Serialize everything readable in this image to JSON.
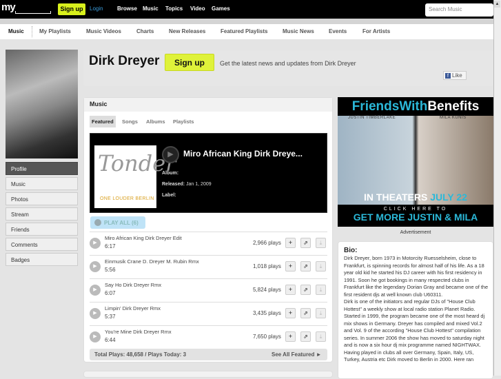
{
  "topbar": {
    "logo": "my",
    "signup": "Sign up",
    "login": "Login",
    "nav": [
      "Browse",
      "Music",
      "Topics",
      "Video",
      "Games"
    ],
    "search_placeholder": "Search Music"
  },
  "subnav": [
    "Music",
    "My Playlists",
    "Music Videos",
    "Charts",
    "New Releases",
    "Featured Playlists",
    "Music News",
    "Events",
    "For Artists"
  ],
  "sidebar": [
    "Profile",
    "Music",
    "Photos",
    "Stream",
    "Friends",
    "Comments",
    "Badges"
  ],
  "header": {
    "artist": "Dirk Dreyer",
    "signup": "Sign up",
    "tagline": "Get the latest news and updates from Dirk Dreyer",
    "like": "Like"
  },
  "music": {
    "title": "Music",
    "tabs": [
      "Featured",
      "Songs",
      "Albums",
      "Playlists"
    ],
    "featured": {
      "label": "",
      "title": "Miro African King Dirk Dreye...",
      "album_label": "Album:",
      "album": "",
      "released_label": "Released:",
      "released": "Jan 1, 2009",
      "label_label": "Label:",
      "cover_text": "Tonder",
      "cover_sub": "ONE LOUDER BERLIN"
    },
    "play_all": "PLAY ALL (6)",
    "tracks": [
      {
        "name": "Miro African King Dirk Dreyer Edit",
        "duration": "6:17",
        "plays": "2,966 plays"
      },
      {
        "name": "Einmusik Crane D. Dreyer M. Rubin Rmx",
        "duration": "5:56",
        "plays": "1,018 plays"
      },
      {
        "name": "Say Ho Dirk Dreyer Rmx",
        "duration": "6:07",
        "plays": "5,824 plays"
      },
      {
        "name": "Limpin' Dirk Dreyer Rmx",
        "duration": "5:37",
        "plays": "3,435 plays"
      },
      {
        "name": "You're Mine Dirk Dreyer Rmx",
        "duration": "6:44",
        "plays": "7,650 plays"
      }
    ],
    "totals": "Total Plays: 48,658 / Plays Today: 3",
    "see_all": "See All Featured ►"
  },
  "ad": {
    "title_a": "Friends",
    "title_b": "With",
    "title_c": "Benefits",
    "name1": "JUSTIN TIMBERLAKE",
    "name2": "MILA KUNIS",
    "theaters": "IN THEATERS",
    "date": "JULY 22",
    "click": "CLICK HERE TO",
    "get": "GET MORE JUSTIN & MILA",
    "label": "Advertisement"
  },
  "bio": {
    "title": "Bio:",
    "paragraphs": [
      "Dirk Dreyer, born 1973 in Motorcity Ruesselsheim, close to Frankfurt, is spinning records for almost half of his life. As a 18 year old kid he started his DJ career with his first residency in 1991. Soon he got bookings in many respected clubs in Frankfurt like the legendary Dorian Gray and became one of the first resident djs at well known club U60311.",
      "Dirk is one of the initiators and regular DJs of \"House Club Hottest\" a weekly show at local radio station Planet Radio. Started in 1999, the program became one of the most heard dj mix shows in Germany. Dreyer has compiled and mixed Vol.2 and Vol. 9 of the according \"House Club Hottest\" compilation series. In summer 2006 the show has moved to saturday night and is now a six hour dj mix programme named NIGHTWAX.",
      "Having played in clubs all over Germany, Spain, Italy, US, Turkey, Austria etc Dirk moved to Berlin in 2000. Here ran"
    ]
  }
}
